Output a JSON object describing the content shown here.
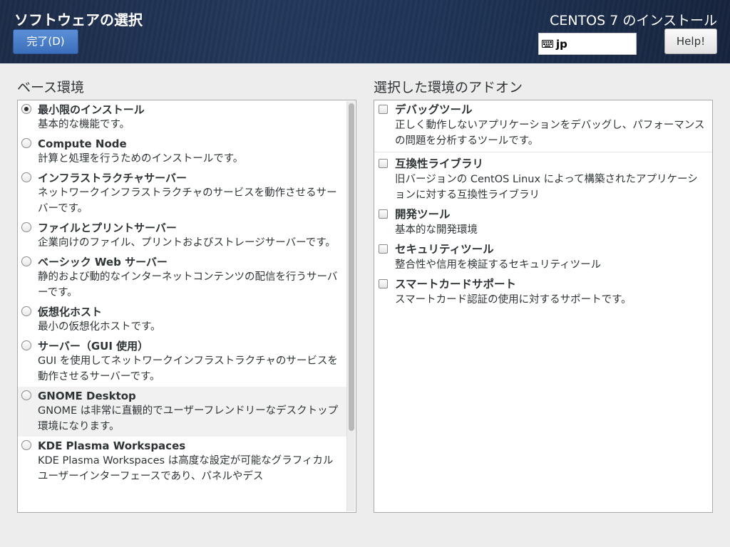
{
  "header": {
    "page_title": "ソフトウェアの選択",
    "done_label": "完了(D)",
    "product_title": "CENTOS 7 のインストール",
    "keyboard_layout": "jp",
    "help_label": "Help!"
  },
  "base_environment": {
    "heading": "ベース環境",
    "items": [
      {
        "title": "最小限のインストール",
        "description": "基本的な機能です。",
        "selected": true
      },
      {
        "title": "Compute Node",
        "description": "計算と処理を行うためのインストールです。",
        "selected": false
      },
      {
        "title": "インフラストラクチャサーバー",
        "description": "ネットワークインフラストラクチャのサービスを動作させるサーバーです。",
        "selected": false
      },
      {
        "title": "ファイルとプリントサーバー",
        "description": "企業向けのファイル、プリントおよびストレージサーバーです。",
        "selected": false
      },
      {
        "title": "ベーシック Web サーバー",
        "description": "静的および動的なインターネットコンテンツの配信を行うサーバーです。",
        "selected": false
      },
      {
        "title": "仮想化ホスト",
        "description": "最小の仮想化ホストです。",
        "selected": false
      },
      {
        "title": "サーバー（GUI 使用）",
        "description": "GUI を使用してネットワークインフラストラクチャのサービスを動作させるサーバーです。",
        "selected": false
      },
      {
        "title": "GNOME Desktop",
        "description": "GNOME は非常に直観的でユーザーフレンドリーなデスクトップ環境になります。",
        "selected": false
      },
      {
        "title": "KDE Plasma Workspaces",
        "description": "KDE Plasma Workspaces は高度な設定が可能なグラフィカルユーザーインターフェースであり、パネルやデス",
        "selected": false
      }
    ]
  },
  "addons": {
    "heading": "選択した環境のアドオン",
    "items": [
      {
        "title": "デバッグツール",
        "description": "正しく動作しないアプリケーションをデバッグし、パフォーマンスの問題を分析するツールです。"
      },
      {
        "title": "互換性ライブラリ",
        "description": "旧バージョンの CentOS Linux によって構築されたアプリケーションに対する互換性ライブラリ"
      },
      {
        "title": "開発ツール",
        "description": "基本的な開発環境"
      },
      {
        "title": "セキュリティツール",
        "description": "整合性や信用を検証するセキュリティツール"
      },
      {
        "title": "スマートカードサポート",
        "description": "スマートカード認証の使用に対するサポートです。"
      }
    ]
  }
}
